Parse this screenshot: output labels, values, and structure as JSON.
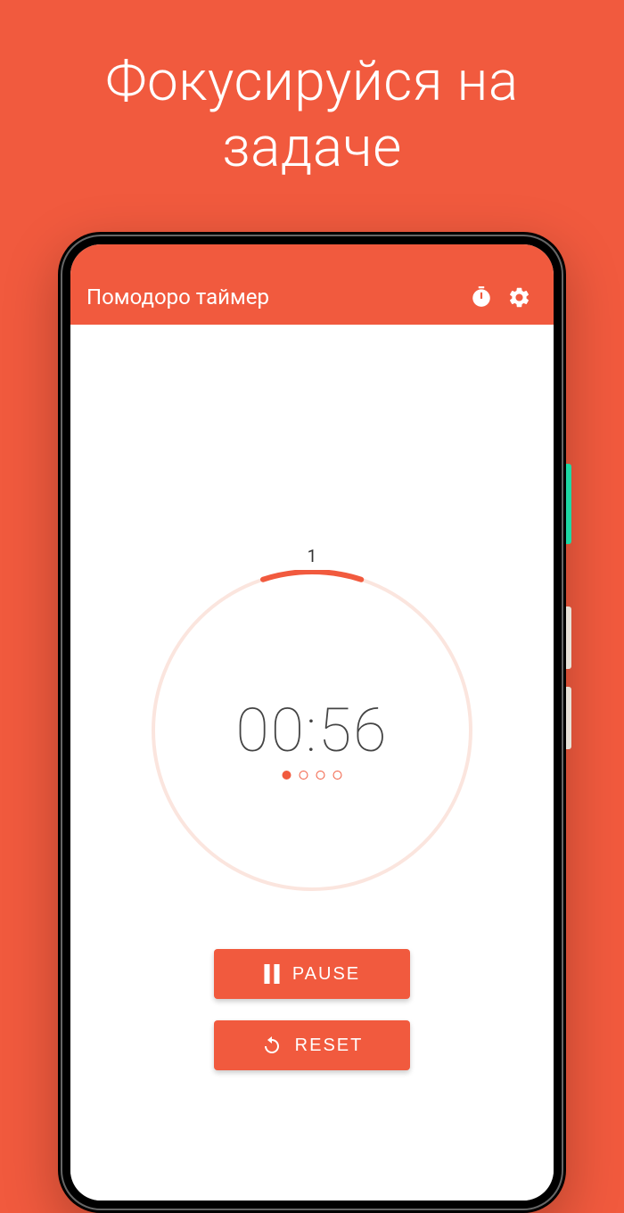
{
  "promo": {
    "title": "Фокусируйся на задаче"
  },
  "header": {
    "title": "Помодоро таймер"
  },
  "timer": {
    "session_number": "1",
    "time": "00:56",
    "progress_percent": 10,
    "total_sessions": 4,
    "active_session": 1
  },
  "buttons": {
    "pause": "PAUSE",
    "reset": "RESET"
  },
  "colors": {
    "accent": "#f15a3e",
    "ring_bg": "#fbe5de"
  }
}
